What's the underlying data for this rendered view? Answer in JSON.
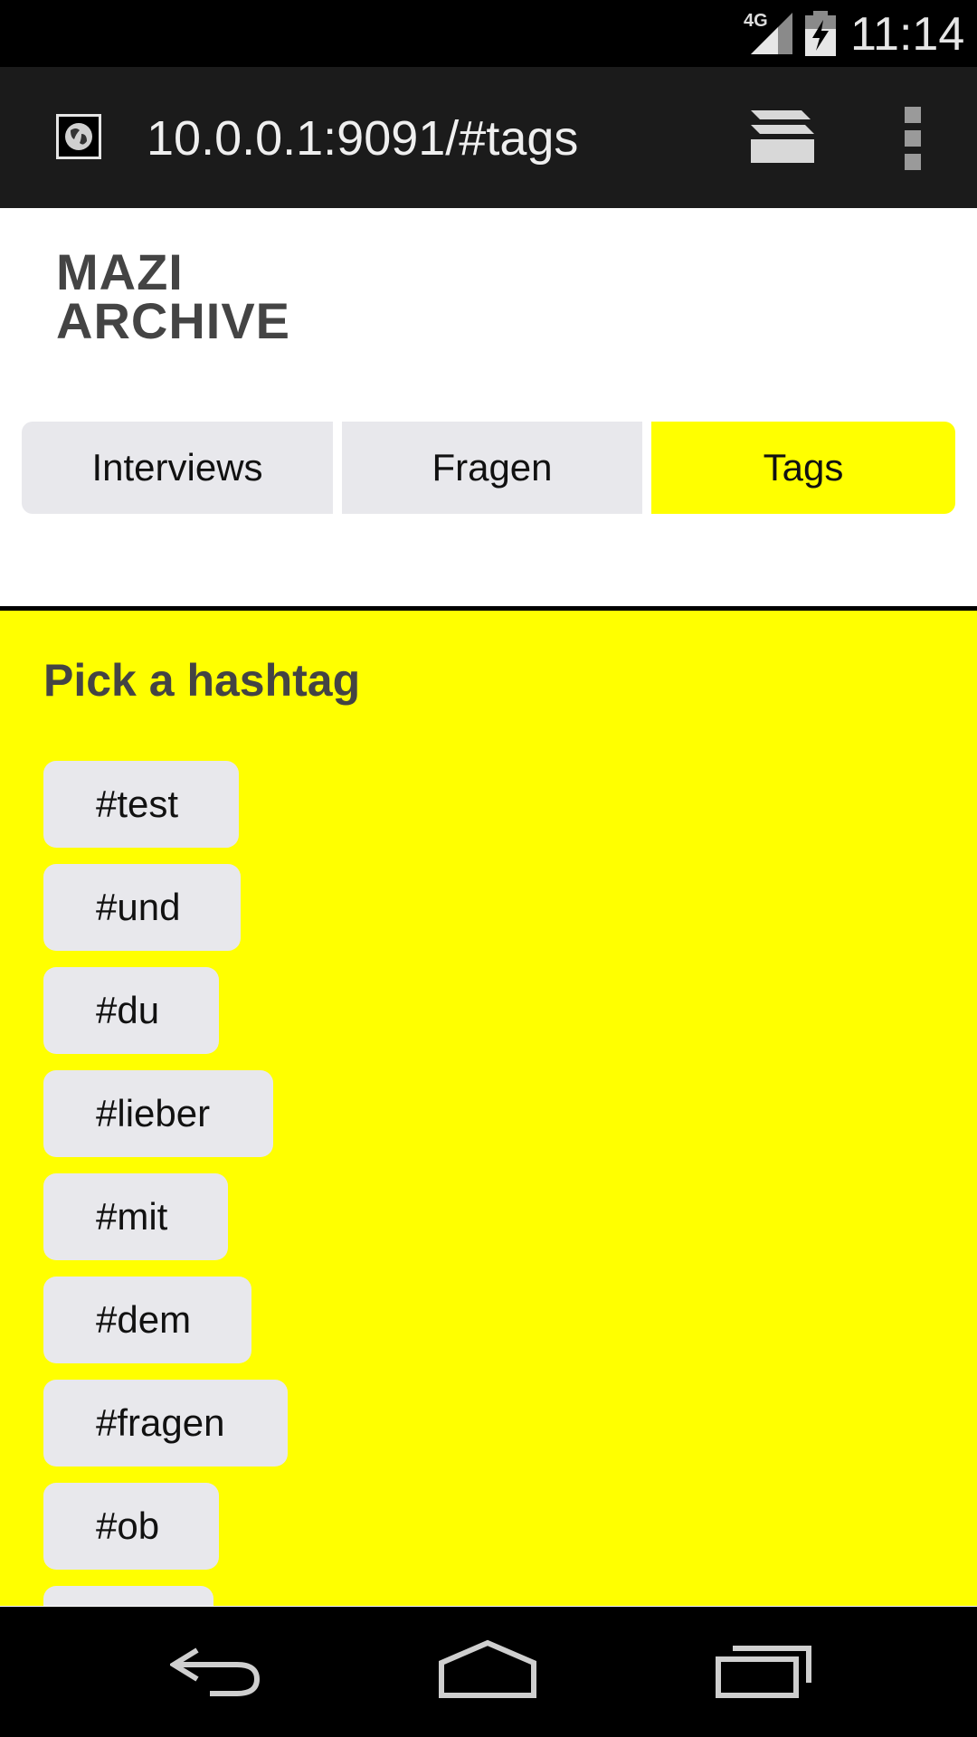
{
  "status_bar": {
    "network": "4G",
    "time": "11:14"
  },
  "browser": {
    "url": "10.0.0.1:9091/#tags",
    "favicon": "globe-icon",
    "tabs_icon": "tabs-stack-icon",
    "menu_icon": "overflow-menu-icon"
  },
  "header": {
    "logo_line1": "MAZI",
    "logo_line2": "ARCHIVE"
  },
  "nav": {
    "tabs": [
      {
        "label": "Interviews"
      },
      {
        "label": "Fragen"
      },
      {
        "label": "Tags"
      }
    ],
    "active_color": "#ffff00"
  },
  "main": {
    "title": "Pick a hashtag",
    "tags": [
      {
        "label": "#test"
      },
      {
        "label": "#und"
      },
      {
        "label": "#du"
      },
      {
        "label": "#lieber"
      },
      {
        "label": "#mit"
      },
      {
        "label": "#dem"
      },
      {
        "label": "#fragen"
      },
      {
        "label": "#ob"
      }
    ],
    "background_color": "#ffff00"
  },
  "system_nav": {
    "back_icon": "back-icon",
    "home_icon": "home-icon",
    "recents_icon": "recents-icon"
  }
}
